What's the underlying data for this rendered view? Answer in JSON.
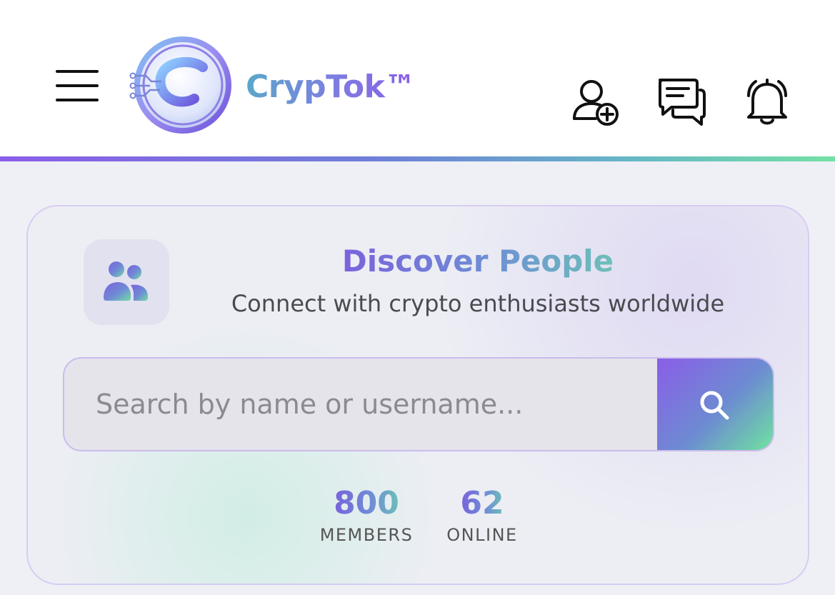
{
  "header": {
    "brand": "CrypTok™",
    "menu_icon": "hamburger-menu-icon",
    "actions": [
      {
        "icon": "add-user-icon"
      },
      {
        "icon": "chat-bubbles-icon"
      },
      {
        "icon": "bell-icon"
      }
    ],
    "accent_gradient": [
      "#8b5ee8",
      "#6f7fd8",
      "#66b6c6",
      "#74e0a6"
    ]
  },
  "discover": {
    "badge_icon": "people-icon",
    "title": "Discover People",
    "subtitle": "Connect with crypto enthusiasts worldwide",
    "search": {
      "placeholder": "Search by name or username...",
      "value": "",
      "button_icon": "search-icon"
    },
    "stats": [
      {
        "value": "800",
        "label": "MEMBERS"
      },
      {
        "value": "62",
        "label": "ONLINE"
      }
    ]
  }
}
